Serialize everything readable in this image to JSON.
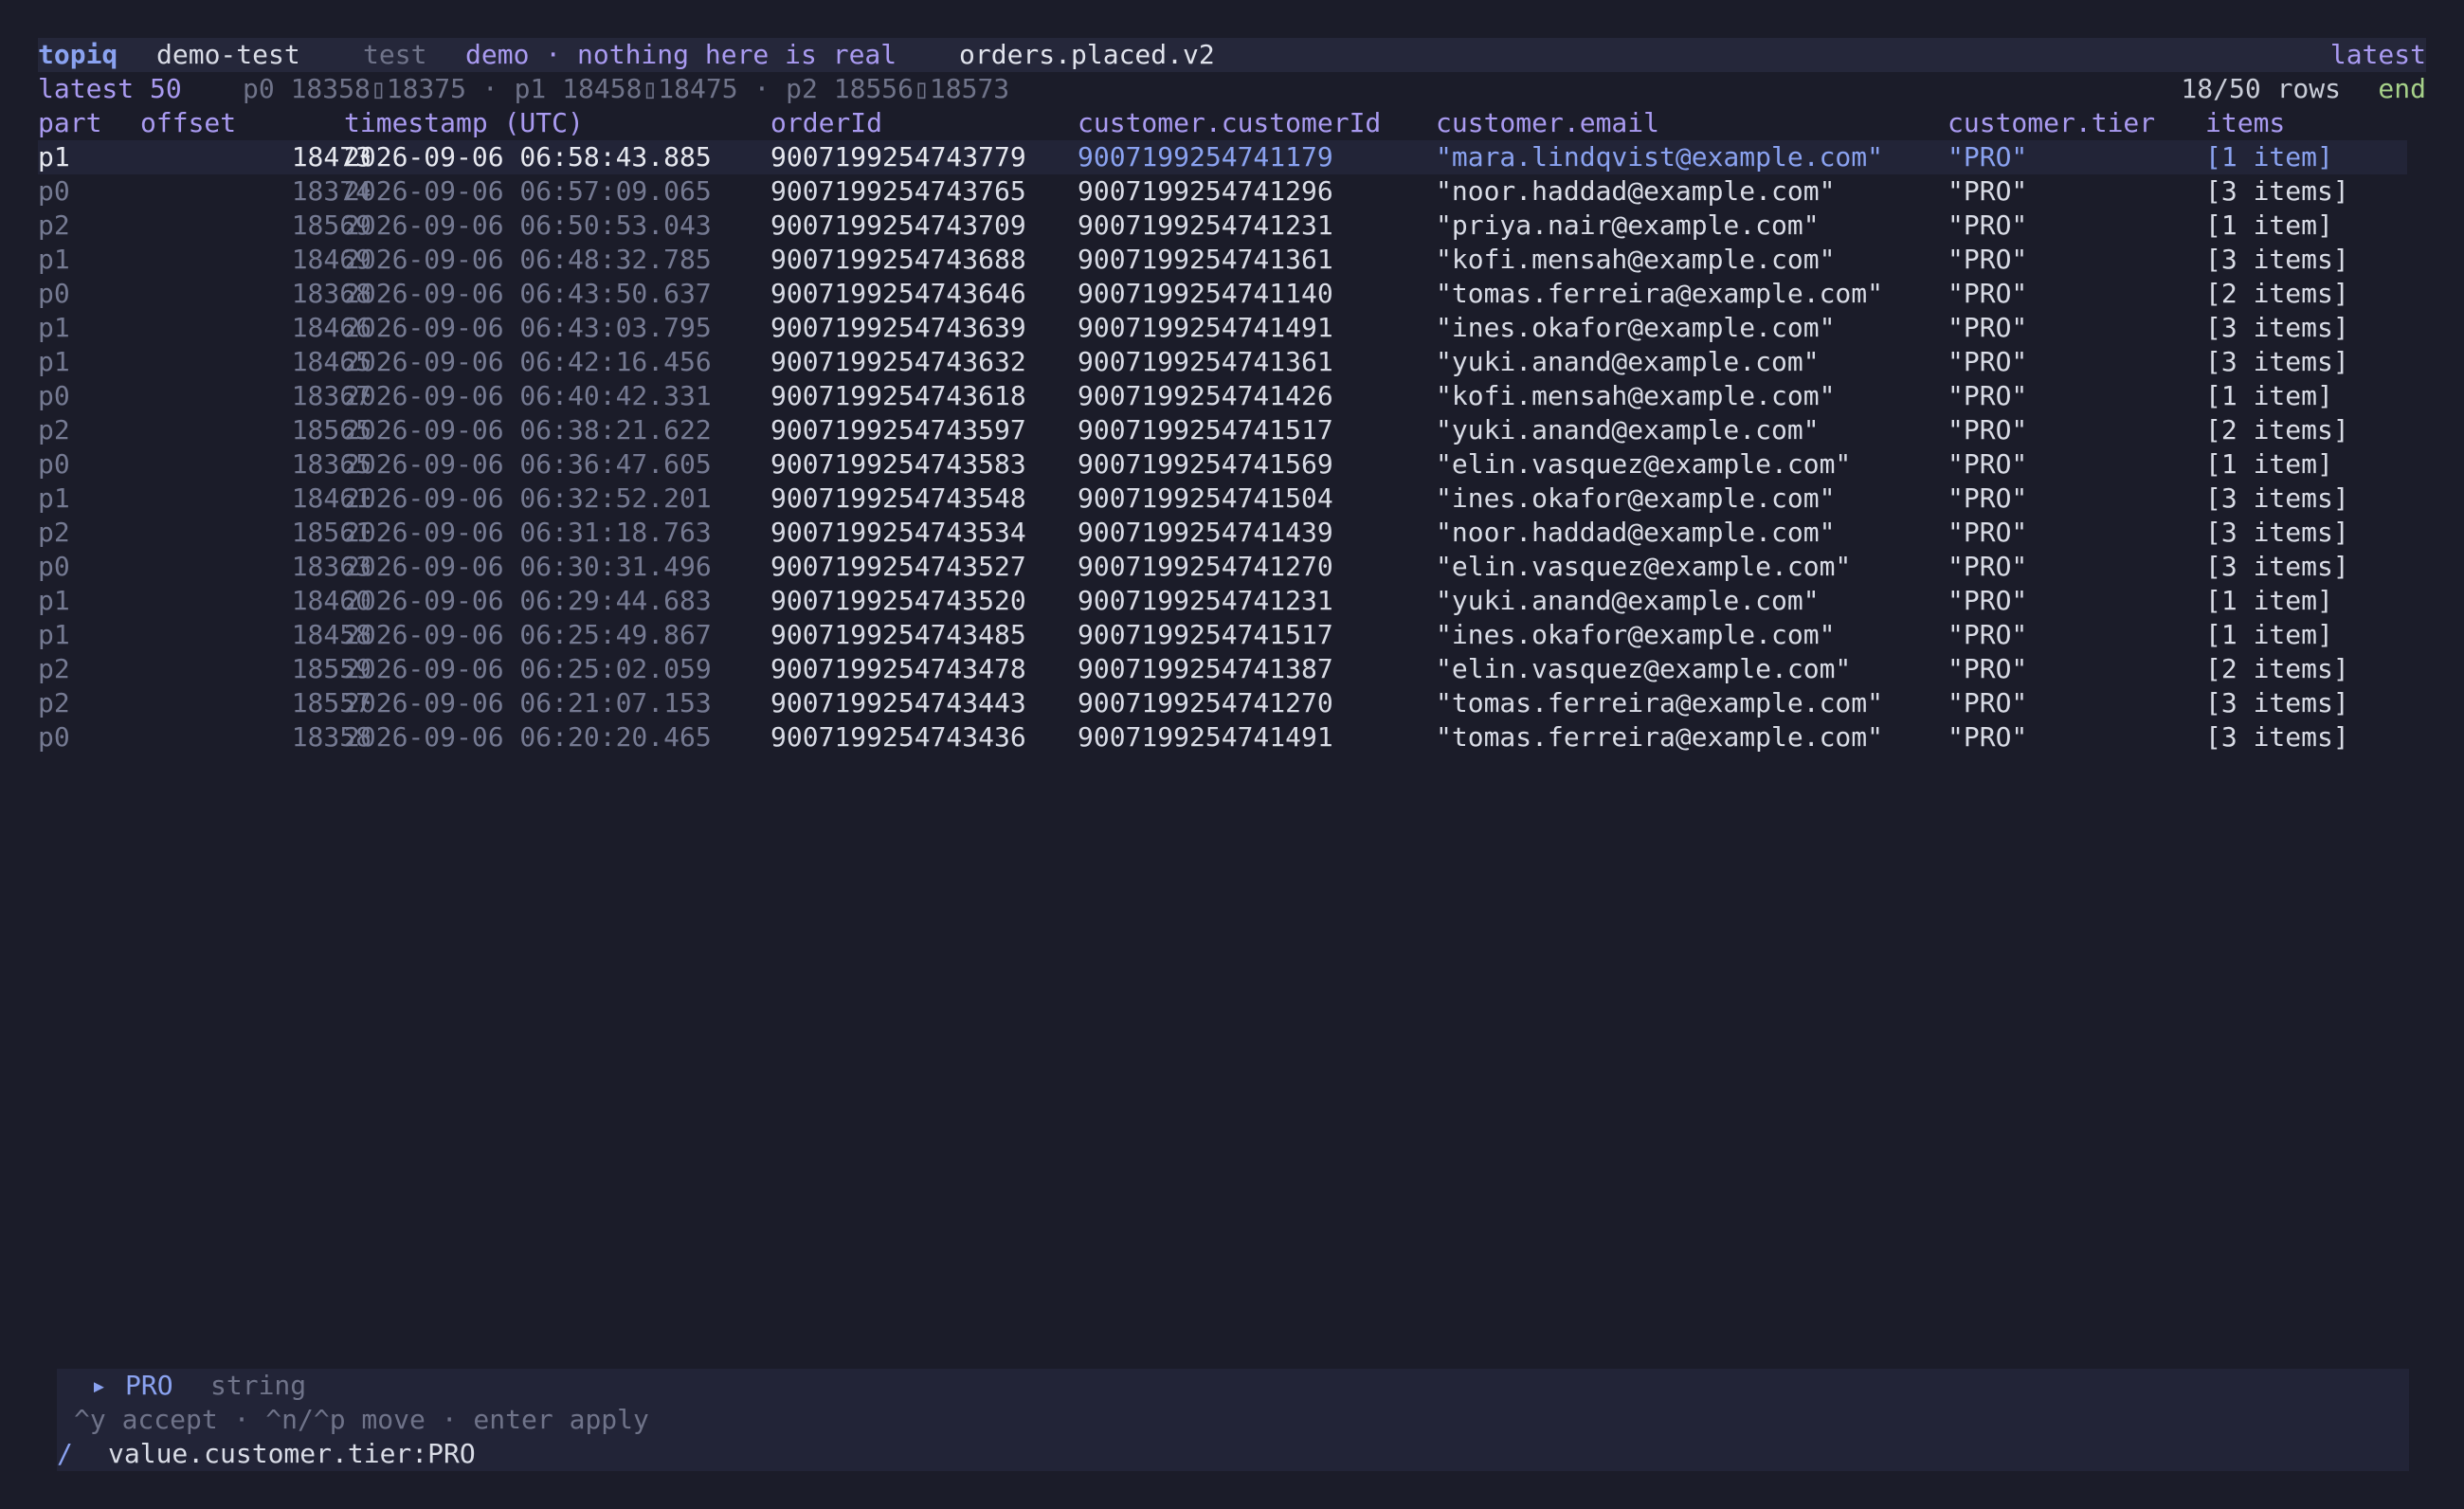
{
  "header": {
    "brand": "topiq",
    "cluster": "demo-test",
    "env": "test",
    "note": "demo · nothing here is real",
    "topic": "orders.placed.v2",
    "mode": "latest"
  },
  "subheader": {
    "window": "latest 50",
    "ranges": "p0 18358▯18375 · p1 18458▯18475 · p2 18556▯18573",
    "rows": "18/50 rows",
    "position": "end"
  },
  "columns": [
    "part",
    "offset",
    "timestamp (UTC)",
    "orderId",
    "customer.customerId",
    "customer.email",
    "customer.tier",
    "items"
  ],
  "rows": [
    {
      "part": "p1",
      "offset": "18473",
      "ts": "2026-09-06 06:58:43.885",
      "orderId": "9007199254743779",
      "customerId": "9007199254741179",
      "email": "\"mara.lindqvist@example.com\"",
      "tier": "\"PRO\"",
      "items": "[1 item]"
    },
    {
      "part": "p0",
      "offset": "18374",
      "ts": "2026-09-06 06:57:09.065",
      "orderId": "9007199254743765",
      "customerId": "9007199254741296",
      "email": "\"noor.haddad@example.com\"",
      "tier": "\"PRO\"",
      "items": "[3 items]"
    },
    {
      "part": "p2",
      "offset": "18569",
      "ts": "2026-09-06 06:50:53.043",
      "orderId": "9007199254743709",
      "customerId": "9007199254741231",
      "email": "\"priya.nair@example.com\"",
      "tier": "\"PRO\"",
      "items": "[1 item]"
    },
    {
      "part": "p1",
      "offset": "18469",
      "ts": "2026-09-06 06:48:32.785",
      "orderId": "9007199254743688",
      "customerId": "9007199254741361",
      "email": "\"kofi.mensah@example.com\"",
      "tier": "\"PRO\"",
      "items": "[3 items]"
    },
    {
      "part": "p0",
      "offset": "18368",
      "ts": "2026-09-06 06:43:50.637",
      "orderId": "9007199254743646",
      "customerId": "9007199254741140",
      "email": "\"tomas.ferreira@example.com\"",
      "tier": "\"PRO\"",
      "items": "[2 items]"
    },
    {
      "part": "p1",
      "offset": "18466",
      "ts": "2026-09-06 06:43:03.795",
      "orderId": "9007199254743639",
      "customerId": "9007199254741491",
      "email": "\"ines.okafor@example.com\"",
      "tier": "\"PRO\"",
      "items": "[3 items]"
    },
    {
      "part": "p1",
      "offset": "18465",
      "ts": "2026-09-06 06:42:16.456",
      "orderId": "9007199254743632",
      "customerId": "9007199254741361",
      "email": "\"yuki.anand@example.com\"",
      "tier": "\"PRO\"",
      "items": "[3 items]"
    },
    {
      "part": "p0",
      "offset": "18367",
      "ts": "2026-09-06 06:40:42.331",
      "orderId": "9007199254743618",
      "customerId": "9007199254741426",
      "email": "\"kofi.mensah@example.com\"",
      "tier": "\"PRO\"",
      "items": "[1 item]"
    },
    {
      "part": "p2",
      "offset": "18565",
      "ts": "2026-09-06 06:38:21.622",
      "orderId": "9007199254743597",
      "customerId": "9007199254741517",
      "email": "\"yuki.anand@example.com\"",
      "tier": "\"PRO\"",
      "items": "[2 items]"
    },
    {
      "part": "p0",
      "offset": "18365",
      "ts": "2026-09-06 06:36:47.605",
      "orderId": "9007199254743583",
      "customerId": "9007199254741569",
      "email": "\"elin.vasquez@example.com\"",
      "tier": "\"PRO\"",
      "items": "[1 item]"
    },
    {
      "part": "p1",
      "offset": "18461",
      "ts": "2026-09-06 06:32:52.201",
      "orderId": "9007199254743548",
      "customerId": "9007199254741504",
      "email": "\"ines.okafor@example.com\"",
      "tier": "\"PRO\"",
      "items": "[3 items]"
    },
    {
      "part": "p2",
      "offset": "18561",
      "ts": "2026-09-06 06:31:18.763",
      "orderId": "9007199254743534",
      "customerId": "9007199254741439",
      "email": "\"noor.haddad@example.com\"",
      "tier": "\"PRO\"",
      "items": "[3 items]"
    },
    {
      "part": "p0",
      "offset": "18363",
      "ts": "2026-09-06 06:30:31.496",
      "orderId": "9007199254743527",
      "customerId": "9007199254741270",
      "email": "\"elin.vasquez@example.com\"",
      "tier": "\"PRO\"",
      "items": "[3 items]"
    },
    {
      "part": "p1",
      "offset": "18460",
      "ts": "2026-09-06 06:29:44.683",
      "orderId": "9007199254743520",
      "customerId": "9007199254741231",
      "email": "\"yuki.anand@example.com\"",
      "tier": "\"PRO\"",
      "items": "[1 item]"
    },
    {
      "part": "p1",
      "offset": "18458",
      "ts": "2026-09-06 06:25:49.867",
      "orderId": "9007199254743485",
      "customerId": "9007199254741517",
      "email": "\"ines.okafor@example.com\"",
      "tier": "\"PRO\"",
      "items": "[1 item]"
    },
    {
      "part": "p2",
      "offset": "18559",
      "ts": "2026-09-06 06:25:02.059",
      "orderId": "9007199254743478",
      "customerId": "9007199254741387",
      "email": "\"elin.vasquez@example.com\"",
      "tier": "\"PRO\"",
      "items": "[2 items]"
    },
    {
      "part": "p2",
      "offset": "18557",
      "ts": "2026-09-06 06:21:07.153",
      "orderId": "9007199254743443",
      "customerId": "9007199254741270",
      "email": "\"tomas.ferreira@example.com\"",
      "tier": "\"PRO\"",
      "items": "[3 items]"
    },
    {
      "part": "p0",
      "offset": "18358",
      "ts": "2026-09-06 06:20:20.465",
      "orderId": "9007199254743436",
      "customerId": "9007199254741491",
      "email": "\"tomas.ferreira@example.com\"",
      "tier": "\"PRO\"",
      "items": "[3 items]"
    }
  ],
  "suggestion": {
    "icon": "▸",
    "value": "PRO",
    "type": "string"
  },
  "hint": "^y accept · ^n/^p move · enter apply",
  "query": {
    "prompt": "/",
    "text": "value.customer.tier:PRO"
  }
}
